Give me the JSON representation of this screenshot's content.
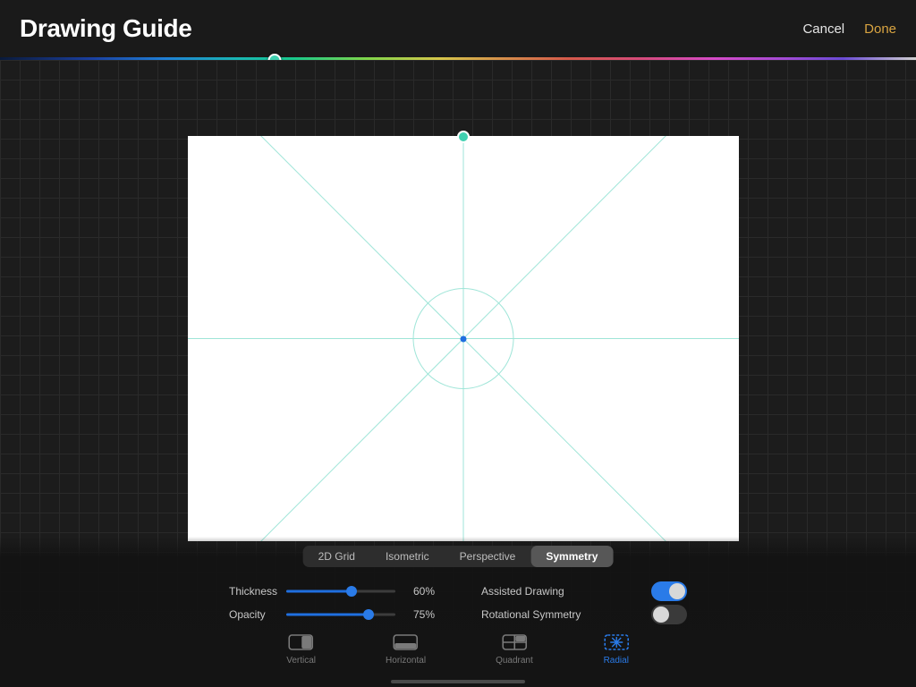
{
  "header": {
    "title": "Drawing Guide",
    "cancel": "Cancel",
    "done": "Done"
  },
  "hue_slider_percent": 30,
  "guide_tabs": [
    "2D Grid",
    "Isometric",
    "Perspective",
    "Symmetry"
  ],
  "guide_tab_active": 3,
  "sliders": {
    "thickness": {
      "label": "Thickness",
      "percent": 60,
      "display": "60%"
    },
    "opacity": {
      "label": "Opacity",
      "percent": 75,
      "display": "75%"
    }
  },
  "toggles": {
    "assisted": {
      "label": "Assisted Drawing",
      "on": true
    },
    "rotational": {
      "label": "Rotational Symmetry",
      "on": false
    }
  },
  "symmetry_types": [
    "Vertical",
    "Horizontal",
    "Quadrant",
    "Radial"
  ],
  "symmetry_active": 3,
  "colors": {
    "accent": "#2a7be8",
    "guide_line": "#9fe5d8",
    "done": "#d9a441"
  }
}
